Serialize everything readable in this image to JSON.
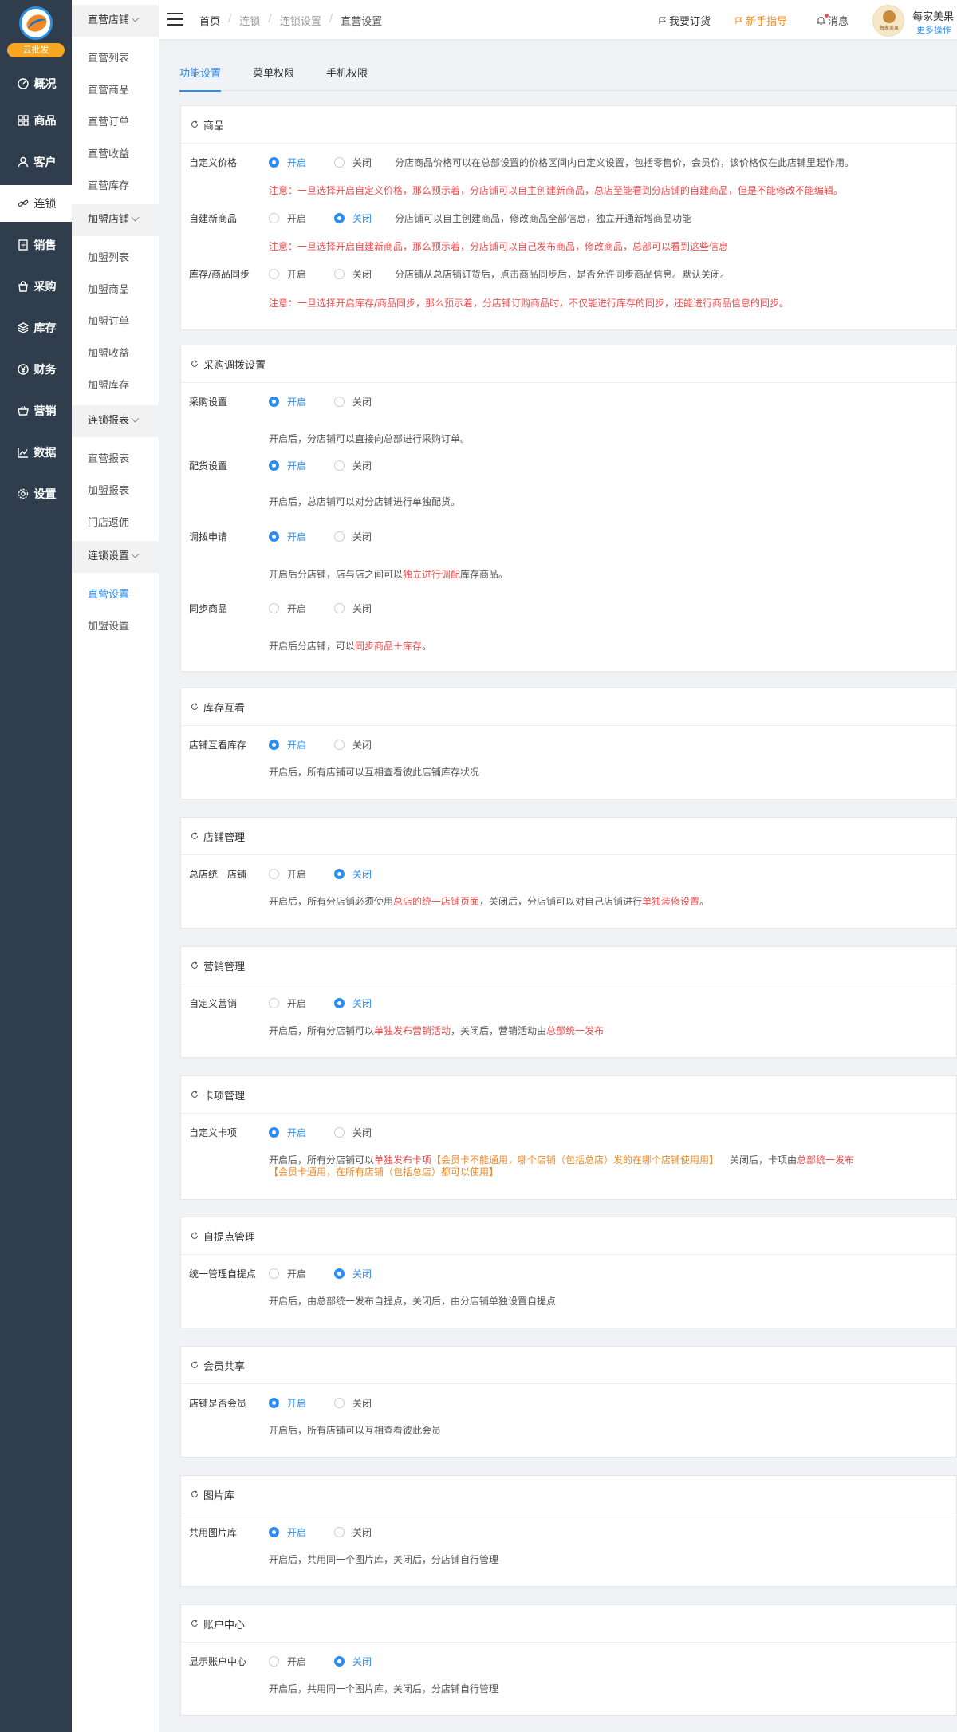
{
  "brand": {
    "badge": "云批发"
  },
  "nav": [
    {
      "label": "概况",
      "icon": "dashboard-icon"
    },
    {
      "label": "商品",
      "icon": "grid-icon"
    },
    {
      "label": "客户",
      "icon": "user-icon"
    },
    {
      "label": "连锁",
      "icon": "link-icon"
    },
    {
      "label": "销售",
      "icon": "document-icon"
    },
    {
      "label": "采购",
      "icon": "bag-icon"
    },
    {
      "label": "库存",
      "icon": "layers-icon"
    },
    {
      "label": "财务",
      "icon": "yen-icon"
    },
    {
      "label": "营销",
      "icon": "basket-icon"
    },
    {
      "label": "数据",
      "icon": "chart-icon"
    },
    {
      "label": "设置",
      "icon": "gear-icon"
    }
  ],
  "submenu": {
    "groups": [
      "直营店铺",
      "加盟店铺",
      "连锁报表",
      "连锁设置"
    ],
    "direct": [
      "直营列表",
      "直营商品",
      "直营订单",
      "直营收益",
      "直营库存"
    ],
    "franchise": [
      "加盟列表",
      "加盟商品",
      "加盟订单",
      "加盟收益",
      "加盟库存"
    ],
    "reports": [
      "直营报表",
      "加盟报表",
      "门店返佣"
    ],
    "settings": [
      "直营设置",
      "加盟设置"
    ]
  },
  "header": {
    "breadcrumb": [
      "首页",
      "连锁",
      "连锁设置",
      "直营设置"
    ],
    "order_link": "我要订货",
    "guide_link": "新手指导",
    "message_link": "消息",
    "avatar_text": "每家美果",
    "user_name": "每家美果",
    "user_sub": "更多操作"
  },
  "tabs": [
    "功能设置",
    "菜单权限",
    "手机权限"
  ],
  "radio_labels": {
    "on": "开启",
    "off": "关闭"
  },
  "sections": {
    "goods": {
      "title": "商品",
      "rows": [
        {
          "label": "自定义价格",
          "state": "on",
          "desc": "分店商品价格可以在总部设置的价格区间内自定义设置，包括零售价，会员价，该价格仅在此店铺里起作用。",
          "warn": "注意：一旦选择开启自定义价格，那么预示着，分店铺可以自主创建新商品，总店至能看到分店铺的自建商品，但是不能修改不能编辑。"
        },
        {
          "label": "自建新商品",
          "state": "off",
          "desc": "分店铺可以自主创建商品，修改商品全部信息，独立开通新增商品功能",
          "warn": "注意：一旦选择开启自建新商品，那么预示着，分店铺可以自己发布商品，修改商品，总部可以看到这些信息"
        },
        {
          "label": "库存/商品同步",
          "state": "none",
          "desc": "分店铺从总店铺订货后，点击商品同步后，是否允许同步商品信息。默认关闭。",
          "warn": "注意：一旦选择开启库存/商品同步，那么预示着，分店铺订购商品时，不仅能进行库存的同步，还能进行商品信息的同步。"
        }
      ]
    },
    "purchase": {
      "title": "采购调拨设置",
      "rows": [
        {
          "label": "采购设置",
          "state": "on",
          "desc": "开启后，分店铺可以直接向总部进行采购订单。"
        },
        {
          "label": "配货设置",
          "state": "on",
          "desc": "开启后，总店铺可以对分店铺进行单独配货。"
        },
        {
          "label": "调拨申请",
          "state": "on",
          "desc_pre": "开启后分店铺，店与店之间可以",
          "desc_hl": "独立进行调配",
          "desc_post": "库存商品。"
        },
        {
          "label": "同步商品",
          "state": "none",
          "desc_pre": "开启后分店铺，可以",
          "desc_hl": "同步商品＋库存",
          "desc_post": "。"
        }
      ]
    },
    "stock": {
      "title": "库存互看",
      "label": "店铺互看库存",
      "state": "on",
      "desc": "开启后，所有店铺可以互相查看彼此店铺库存状况"
    },
    "store": {
      "title": "店铺管理",
      "label": "总店统一店铺",
      "state": "off",
      "desc_pre": "开启后，所有分店铺必须使用",
      "desc_hl1": "总店的统一店铺页面",
      "desc_mid": "，关闭后，分店铺可以对自己店铺进行",
      "desc_hl2": "单独装修设置",
      "desc_post": "。"
    },
    "marketing": {
      "title": "营销管理",
      "label": "自定义营销",
      "state": "off",
      "desc_pre": "开启后，所有分店铺可以",
      "desc_hl1": "单独发布营销活动",
      "desc_mid": "，关闭后，营销活动由",
      "desc_hl2": "总部统一发布",
      "desc_post": ""
    },
    "card": {
      "title": "卡项管理",
      "label": "自定义卡项",
      "state": "on",
      "desc_pre": "开启后，所有分店铺可以",
      "desc_hl1": "单独发布卡项",
      "desc_or1": "【会员卡不能通用，哪个店铺（包括总店）发的在哪个店铺使用用】",
      "desc_mid": "关闭后，卡项由",
      "desc_hl2": "总部统一发布",
      "desc_line2": "【会员卡通用，在所有店铺（包括总店）都可以使用】"
    },
    "pickup": {
      "title": "自提点管理",
      "label": "统一管理自提点",
      "state": "off",
      "desc": "开启后，由总部统一发布自提点，关闭后，由分店铺单独设置自提点"
    },
    "member": {
      "title": "会员共享",
      "label": "店铺是否会员",
      "state": "on",
      "desc": "开启后，所有店铺可以互相查看彼此会员"
    },
    "gallery": {
      "title": "图片库",
      "label": "共用图片库",
      "state": "on",
      "desc": "开启后，共用同一个图片库，关闭后，分店铺自行管理"
    },
    "account": {
      "title": "账户中心",
      "label": "显示账户中心",
      "state": "off",
      "desc": "开启后，共用同一个图片库，关闭后，分店铺自行管理"
    }
  }
}
